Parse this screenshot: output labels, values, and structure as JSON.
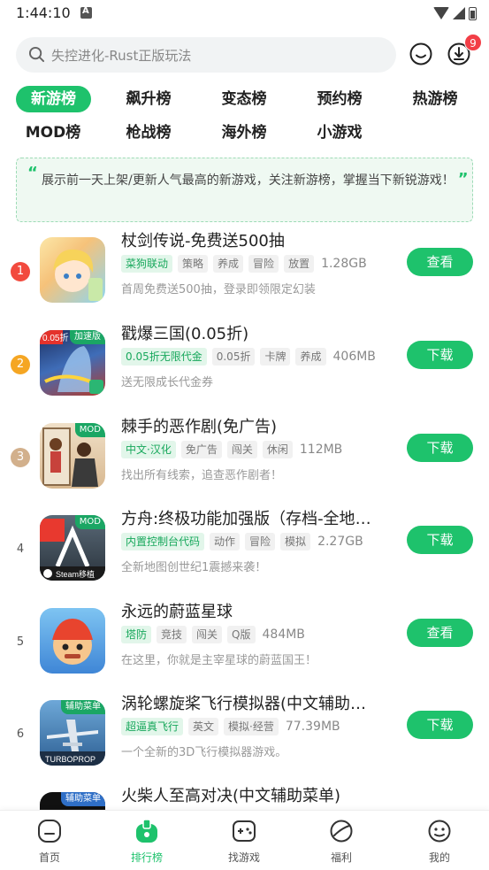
{
  "status_bar": {
    "time": "1:44:10"
  },
  "search": {
    "placeholder": "失控进化-Rust正版玩法"
  },
  "header": {
    "download_badge": "9"
  },
  "categories": [
    {
      "label": "新游榜"
    },
    {
      "label": "飙升榜"
    },
    {
      "label": "变态榜"
    },
    {
      "label": "预约榜"
    },
    {
      "label": "热游榜"
    },
    {
      "label": "MOD榜"
    },
    {
      "label": "枪战榜"
    },
    {
      "label": "海外榜"
    },
    {
      "label": "小游戏"
    }
  ],
  "active_category": "新游榜",
  "banner": {
    "text": "展示前一天上架/更新人气最高的新游戏，关注新游榜，掌握当下新锐游戏！"
  },
  "games": [
    {
      "rank": "1",
      "title": "杖剑传说-免费送500抽",
      "tags": [
        "菜狗联动",
        "策略",
        "养成",
        "冒险",
        "放置"
      ],
      "size": "1.28GB",
      "desc": "首周免费送500抽，登录即领限定幻装",
      "button": "查看"
    },
    {
      "rank": "2",
      "title": "戳爆三国(0.05折)",
      "ribbon": "加速版",
      "tags": [
        "0.05折无限代金",
        "0.05折",
        "卡牌",
        "养成"
      ],
      "size": "406MB",
      "desc": "送无限成长代金券",
      "button": "下载"
    },
    {
      "rank": "3",
      "title": "棘手的恶作剧(免广告)",
      "ribbon": "MOD",
      "tags": [
        "中文·汉化",
        "免广告",
        "闯关",
        "休闲"
      ],
      "size": "112MB",
      "desc": "找出所有线索，追查恶作剧者！",
      "button": "下载"
    },
    {
      "rank": "4",
      "title": "方舟:终极功能加强版（存档-全地图...",
      "ribbon": "MOD",
      "tags": [
        "内置控制台代码",
        "动作",
        "冒险",
        "模拟"
      ],
      "size": "2.27GB",
      "desc": "全新地图创世纪1震撼来袭！",
      "button": "下载"
    },
    {
      "rank": "5",
      "title": "永远的蔚蓝星球",
      "tags": [
        "塔防",
        "竞技",
        "闯关",
        "Q版"
      ],
      "size": "484MB",
      "desc": "在这里，你就是主宰星球的蔚蓝国王！",
      "button": "查看"
    },
    {
      "rank": "6",
      "title": "涡轮螺旋桨飞行模拟器(中文辅助菜单...",
      "ribbon": "辅助菜单",
      "tags": [
        "超逼真飞行",
        "英文",
        "模拟·经营"
      ],
      "size": "77.39MB",
      "desc": "一个全新的3D飞行模拟器游戏。",
      "button": "下载"
    },
    {
      "rank": "",
      "title": "火柴人至高对决(中文辅助菜单)",
      "ribbon": "辅助菜单",
      "tags": [],
      "size": "",
      "desc": "",
      "button": ""
    }
  ],
  "bottom_nav": [
    {
      "label": "首页",
      "icon": "home-icon"
    },
    {
      "label": "排行榜",
      "icon": "ranking-icon"
    },
    {
      "label": "找游戏",
      "icon": "gamepad-icon"
    },
    {
      "label": "福利",
      "icon": "gift-icon"
    },
    {
      "label": "我的",
      "icon": "profile-icon"
    }
  ],
  "colors": {
    "accent": "#1ec26c",
    "rank1": "#f24a3e",
    "rank2": "#f5a623",
    "rank3": "#d2b08c"
  }
}
